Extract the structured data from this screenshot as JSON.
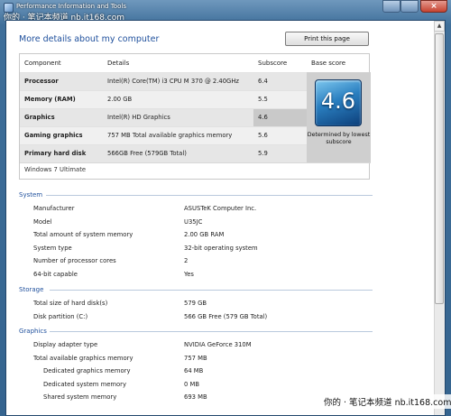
{
  "window": {
    "title": "Performance Information and Tools",
    "close_glyph": "×"
  },
  "watermark": {
    "top": "你的 · 笔记本频道 nb.it168.com",
    "bottom": "你的 · 笔记本频道 nb.it168.com"
  },
  "header": {
    "title": "More details about my computer",
    "print_label": "Print this page"
  },
  "scores": {
    "columns": [
      "Component",
      "Details",
      "Subscore",
      "Base score"
    ],
    "rows": [
      {
        "component": "Processor",
        "details": "Intel(R) Core(TM) i3 CPU M 370 @ 2.40GHz",
        "subscore": "6.4"
      },
      {
        "component": "Memory (RAM)",
        "details": "2.00 GB",
        "subscore": "5.5"
      },
      {
        "component": "Graphics",
        "details": "Intel(R) HD Graphics",
        "subscore": "4.6"
      },
      {
        "component": "Gaming graphics",
        "details": "757 MB Total available graphics memory",
        "subscore": "5.6"
      },
      {
        "component": "Primary hard disk",
        "details": "566GB Free (579GB Total)",
        "subscore": "5.9"
      }
    ],
    "base_score": "4.6",
    "base_caption": "Determined by lowest subscore",
    "os": "Windows 7 Ultimate"
  },
  "sections": {
    "system": {
      "title": "System",
      "rows": [
        {
          "label": "Manufacturer",
          "value": "ASUSTeK Computer Inc."
        },
        {
          "label": "Model",
          "value": "U35JC"
        },
        {
          "label": "Total amount of system memory",
          "value": "2.00 GB RAM"
        },
        {
          "label": "System type",
          "value": "32-bit operating system"
        },
        {
          "label": "Number of processor cores",
          "value": "2"
        },
        {
          "label": "64-bit capable",
          "value": "Yes"
        }
      ]
    },
    "storage": {
      "title": "Storage",
      "rows": [
        {
          "label": "Total size of hard disk(s)",
          "value": "579 GB"
        },
        {
          "label": "Disk partition (C:)",
          "value": "566 GB Free (579 GB Total)"
        }
      ]
    },
    "graphics": {
      "title": "Graphics",
      "rows": [
        {
          "label": "Display adapter type",
          "value": "NVIDIA GeForce 310M"
        },
        {
          "label": "Total available graphics memory",
          "value": "757 MB"
        },
        {
          "label": "Dedicated graphics memory",
          "value": "64 MB"
        },
        {
          "label": "Dedicated system memory",
          "value": "0 MB"
        },
        {
          "label": "Shared system memory",
          "value": "693 MB"
        }
      ]
    }
  },
  "colors": {
    "accent": "#1e4f9c",
    "base_tile": "#2a7fc0",
    "lowest_highlight": "#c9c9c9"
  }
}
